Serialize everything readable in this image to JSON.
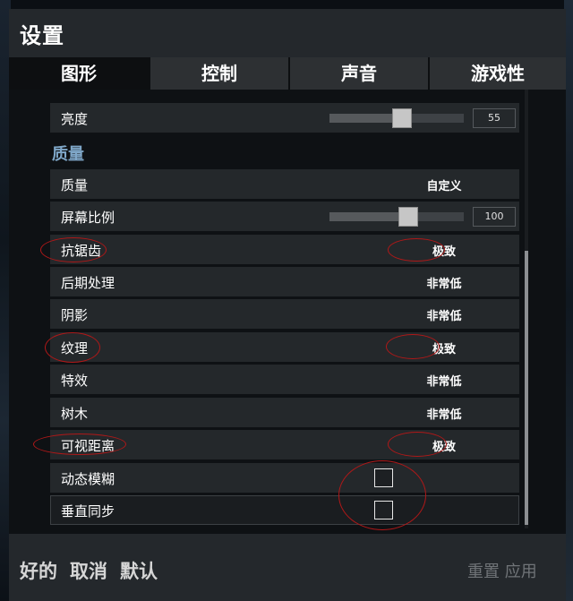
{
  "window": {
    "title": "设置"
  },
  "tabs": [
    {
      "label": "图形",
      "active": true
    },
    {
      "label": "控制",
      "active": false
    },
    {
      "label": "声音",
      "active": false
    },
    {
      "label": "游戏性",
      "active": false
    }
  ],
  "brightness": {
    "label": "亮度",
    "value": "55",
    "level": 0.55
  },
  "section": {
    "title": "质量"
  },
  "rows": {
    "quality": {
      "label": "质量",
      "value": "自定义"
    },
    "screen_scale": {
      "label": "屏幕比例",
      "value": "100",
      "level": 0.6
    },
    "antialiasing": {
      "label": "抗锯齿",
      "value": "极致"
    },
    "post_processing": {
      "label": "后期处理",
      "value": "非常低"
    },
    "shadows": {
      "label": "阴影",
      "value": "非常低"
    },
    "textures": {
      "label": "纹理",
      "value": "极致"
    },
    "effects": {
      "label": "特效",
      "value": "非常低"
    },
    "foliage": {
      "label": "树木",
      "value": "非常低"
    },
    "view_distance": {
      "label": "可视距离",
      "value": "极致"
    },
    "motion_blur": {
      "label": "动态模糊",
      "checked": false
    },
    "vsync": {
      "label": "垂直同步",
      "checked": false
    }
  },
  "footer": {
    "ok_label": "好的",
    "cancel_label": "取消",
    "default_label": "默认",
    "right_text": "重置 应用"
  },
  "colors": {
    "annotation_red": "#b01818",
    "section_blue": "#7fa7c8",
    "row_bg": "#24282b"
  }
}
